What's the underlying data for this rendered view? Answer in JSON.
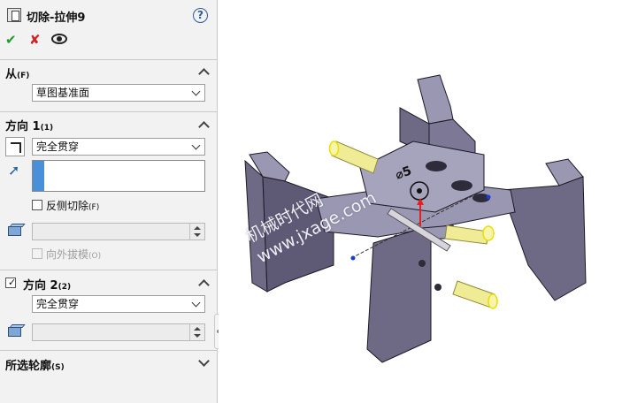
{
  "panel": {
    "title": "切除-拉伸9",
    "help": "?",
    "from": {
      "header": "从",
      "header_key": "(F)",
      "value": "草图基准面"
    },
    "direction1": {
      "header": "方向 1",
      "header_key": "(1)",
      "end_condition": "完全贯穿",
      "flip_side_label": "反侧切除",
      "flip_side_key": "(F)",
      "draft_outward_label": "向外拔模",
      "draft_outward_key": "(O)"
    },
    "direction2": {
      "header": "方向 2",
      "header_key": "(2)",
      "checked": true,
      "end_condition": "完全贯穿"
    },
    "selected_contours": {
      "header": "所选轮廓",
      "header_key": "(S)"
    }
  },
  "viewport": {
    "dimension_label": "⌀5",
    "watermark_line1": "机械时代网",
    "watermark_line2": "www.jxage.com"
  },
  "colors": {
    "part_face": "#6e6a86",
    "part_top": "#9a97b2",
    "part_edge": "#1c1a26",
    "pin_yellow": "#f0ec96",
    "accent_blue": "#4a90d9"
  }
}
